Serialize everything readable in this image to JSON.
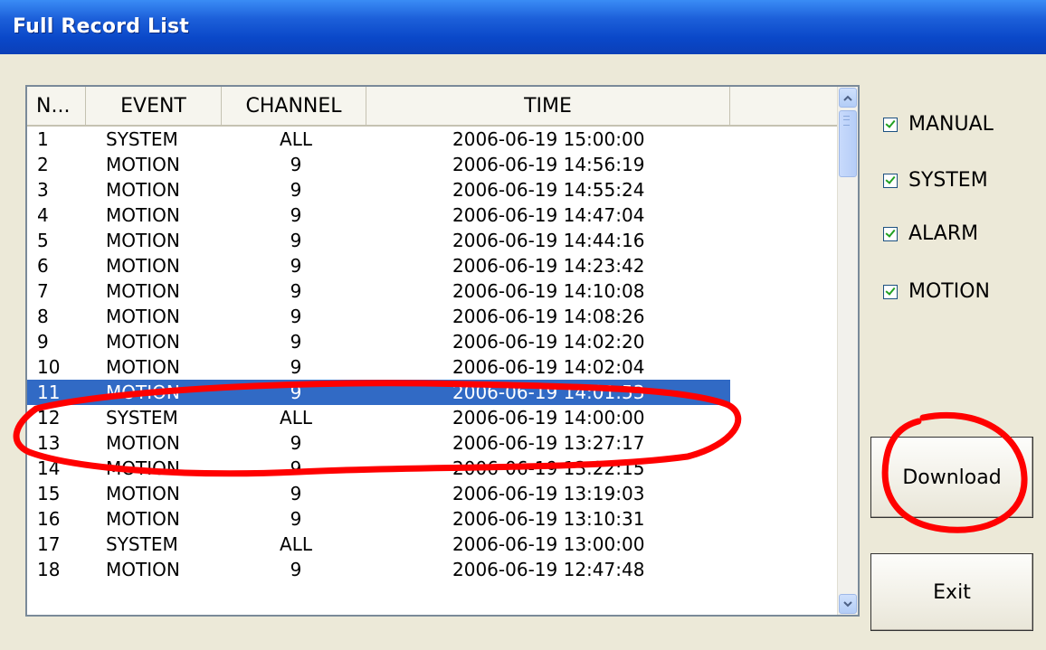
{
  "window": {
    "title": "Full Record List"
  },
  "table": {
    "columns": [
      "N...",
      "EVENT",
      "CHANNEL",
      "TIME",
      ""
    ],
    "rows": [
      {
        "no": "1",
        "event": "SYSTEM",
        "channel": "ALL",
        "time": "2006-06-19  15:00:00"
      },
      {
        "no": "2",
        "event": "MOTION",
        "channel": "9",
        "time": "2006-06-19  14:56:19"
      },
      {
        "no": "3",
        "event": "MOTION",
        "channel": "9",
        "time": "2006-06-19  14:55:24"
      },
      {
        "no": "4",
        "event": "MOTION",
        "channel": "9",
        "time": "2006-06-19  14:47:04"
      },
      {
        "no": "5",
        "event": "MOTION",
        "channel": "9",
        "time": "2006-06-19  14:44:16"
      },
      {
        "no": "6",
        "event": "MOTION",
        "channel": "9",
        "time": "2006-06-19  14:23:42"
      },
      {
        "no": "7",
        "event": "MOTION",
        "channel": "9",
        "time": "2006-06-19  14:10:08"
      },
      {
        "no": "8",
        "event": "MOTION",
        "channel": "9",
        "time": "2006-06-19  14:08:26"
      },
      {
        "no": "9",
        "event": "MOTION",
        "channel": "9",
        "time": "2006-06-19  14:02:20"
      },
      {
        "no": "10",
        "event": "MOTION",
        "channel": "9",
        "time": "2006-06-19  14:02:04"
      },
      {
        "no": "11",
        "event": "MOTION",
        "channel": "9",
        "time": "2006-06-19  14:01:53"
      },
      {
        "no": "12",
        "event": "SYSTEM",
        "channel": "ALL",
        "time": "2006-06-19  14:00:00"
      },
      {
        "no": "13",
        "event": "MOTION",
        "channel": "9",
        "time": "2006-06-19  13:27:17"
      },
      {
        "no": "14",
        "event": "MOTION",
        "channel": "9",
        "time": "2006-06-19  13:22:15"
      },
      {
        "no": "15",
        "event": "MOTION",
        "channel": "9",
        "time": "2006-06-19  13:19:03"
      },
      {
        "no": "16",
        "event": "MOTION",
        "channel": "9",
        "time": "2006-06-19  13:10:31"
      },
      {
        "no": "17",
        "event": "SYSTEM",
        "channel": "ALL",
        "time": "2006-06-19  13:00:00"
      },
      {
        "no": "18",
        "event": "MOTION",
        "channel": "9",
        "time": "2006-06-19  12:47:48"
      }
    ],
    "selected_row": 11
  },
  "filters": [
    {
      "label": "MANUAL",
      "checked": true
    },
    {
      "label": "SYSTEM",
      "checked": true
    },
    {
      "label": "ALARM",
      "checked": true
    },
    {
      "label": "MOTION",
      "checked": true
    }
  ],
  "buttons": {
    "download": "Download",
    "exit": "Exit"
  },
  "icons": {
    "scroll_up": "scroll-up-arrow-icon",
    "scroll_down": "scroll-down-arrow-icon",
    "check": "checkmark-icon"
  },
  "colors": {
    "selection": "#316ac5",
    "annotation": "#ff0000",
    "titlebar": "#0a48c9"
  }
}
